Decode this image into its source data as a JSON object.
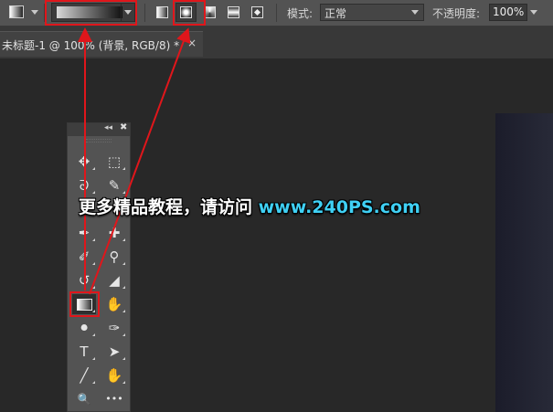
{
  "options_bar": {
    "tool_preset_icon": "gradient-tool-preset-icon",
    "gradient_picker_icon": "gradient-swatch-black-white",
    "gradient_types": [
      {
        "name": "linear-gradient-icon"
      },
      {
        "name": "radial-gradient-icon",
        "selected": true
      },
      {
        "name": "angle-gradient-icon"
      },
      {
        "name": "reflected-gradient-icon"
      },
      {
        "name": "diamond-gradient-icon"
      }
    ],
    "mode_label": "模式:",
    "mode_value": "正常",
    "opacity_label": "不透明度:",
    "opacity_value": "100%"
  },
  "document_tab": {
    "title": "未标题-1 @ 100% (背景, RGB/8) *",
    "close": "×"
  },
  "toolbox": {
    "collapse_glyph": "◂◂",
    "close_glyph": "✖",
    "tools": [
      {
        "name": "move-tool-icon",
        "glyph": "✥"
      },
      {
        "name": "marquee-tool-icon",
        "glyph": "⬚"
      },
      {
        "name": "lasso-tool-icon",
        "glyph": "ᘐ"
      },
      {
        "name": "quick-selection-tool-icon",
        "glyph": "✎"
      },
      {
        "name": "eyedropper-tool-icon",
        "glyph": "✒"
      },
      {
        "name": "healing-brush-tool-icon",
        "glyph": "✚"
      },
      {
        "name": "brush-tool-icon",
        "glyph": "✐"
      },
      {
        "name": "clone-stamp-tool-icon",
        "glyph": "⚲"
      },
      {
        "name": "history-brush-tool-icon",
        "glyph": "↺"
      },
      {
        "name": "eraser-tool-icon",
        "glyph": "◢"
      },
      {
        "name": "gradient-tool-icon",
        "glyph": ""
      },
      {
        "name": "blur-tool-icon",
        "glyph": "✋"
      },
      {
        "name": "dodge-tool-icon",
        "glyph": "⚫"
      },
      {
        "name": "pen-tool-icon",
        "glyph": "✑"
      },
      {
        "name": "type-tool-icon",
        "glyph": "T"
      },
      {
        "name": "path-selection-tool-icon",
        "glyph": "➤"
      },
      {
        "name": "line-tool-icon",
        "glyph": "╱"
      },
      {
        "name": "hand-tool-icon",
        "glyph": "✋"
      },
      {
        "name": "zoom-tool-icon",
        "glyph": "🔍"
      },
      {
        "name": "more-tools-icon",
        "glyph": "•••"
      }
    ]
  },
  "watermark": {
    "text": "更多精品教程，请访问 ",
    "url": "www.240PS.com"
  },
  "colors": {
    "highlight": "#e0161b",
    "watermark_url": "#3fd0f4",
    "workspace": "#282828",
    "panel": "#535353"
  }
}
